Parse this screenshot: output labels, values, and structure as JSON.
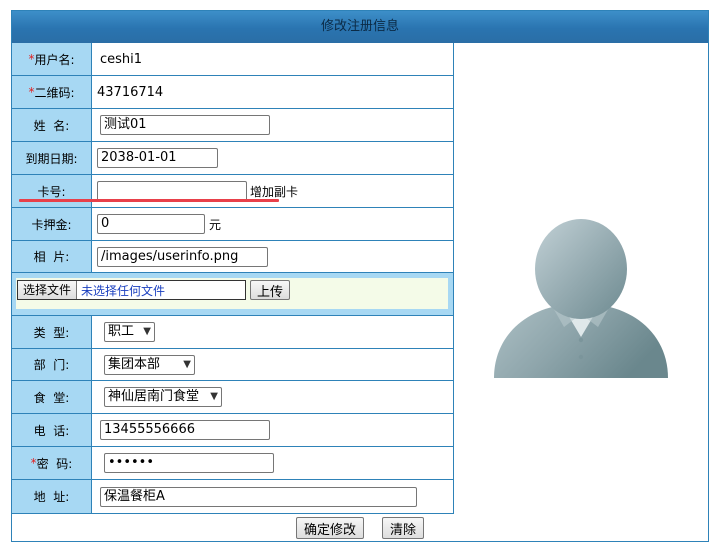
{
  "title": "修改注册信息",
  "fields": {
    "username": {
      "label": "用户名:",
      "required": "*",
      "value": "ceshi1"
    },
    "qrcode": {
      "label": "二维码:",
      "required": "*",
      "value": "43716714"
    },
    "name": {
      "label": "姓  名:",
      "value": "测试01"
    },
    "expire": {
      "label": "到期日期:",
      "value": "2038-01-01"
    },
    "card": {
      "label": "卡号:",
      "value": "",
      "add_link": "增加副卡"
    },
    "deposit": {
      "label": "卡押金:",
      "value": "0",
      "unit": "元"
    },
    "photo": {
      "label": "相  片:",
      "value": "/images/userinfo.png"
    },
    "upload": {
      "choose": "选择文件",
      "no_file": "未选择任何文件",
      "upload_button": "上传"
    },
    "type": {
      "label": "类  型:",
      "selected": "职工"
    },
    "dept": {
      "label": "部  门:",
      "selected": "集团本部"
    },
    "canteen": {
      "label": "食  堂:",
      "selected": "神仙居南门食堂"
    },
    "phone": {
      "label": "电  话:",
      "value": "13455556666"
    },
    "password": {
      "label": "密  码:",
      "required": "*",
      "value": "••••••"
    },
    "address": {
      "label": "地  址:",
      "value": "保温餐柜A"
    }
  },
  "actions": {
    "confirm": "确定修改",
    "clear": "清除"
  },
  "colors": {
    "label_bg": "#a7d8f3",
    "border": "#2e82b8",
    "header": "#2a74b0",
    "highlight": "#e8404a"
  }
}
